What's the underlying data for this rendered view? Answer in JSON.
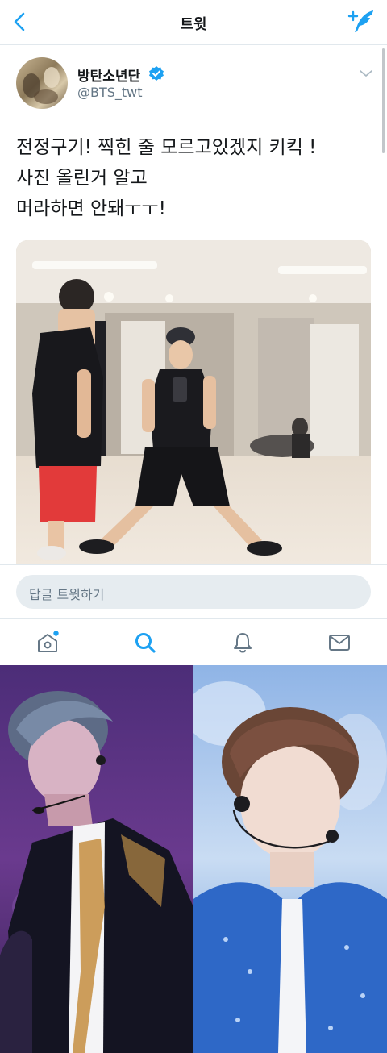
{
  "header": {
    "title": "트윗",
    "back_icon": "chevron-left-icon",
    "compose_icon": "compose-tweet-icon"
  },
  "tweet": {
    "display_name": "방탄소년단",
    "handle": "@BTS_twt",
    "verified": true,
    "text_lines": [
      "전정구기! 찍힌 줄 모르고있겠지 키킥 !",
      "사진 올린거 알고",
      "머라하면 안돼ㅜㅜ!"
    ]
  },
  "reply": {
    "placeholder": "답글 트윗하기"
  },
  "tabs": [
    {
      "name": "home",
      "icon": "home-icon",
      "active": false,
      "has_dot": true
    },
    {
      "name": "search",
      "icon": "search-icon",
      "active": true,
      "has_dot": false
    },
    {
      "name": "notifications",
      "icon": "bell-icon",
      "active": false,
      "has_dot": false
    },
    {
      "name": "messages",
      "icon": "mail-icon",
      "active": false,
      "has_dot": false
    }
  ],
  "colors": {
    "accent": "#1da1f2",
    "inactive_icon": "#657786",
    "text": "#14171a",
    "reply_bg": "#e6ecf0"
  }
}
